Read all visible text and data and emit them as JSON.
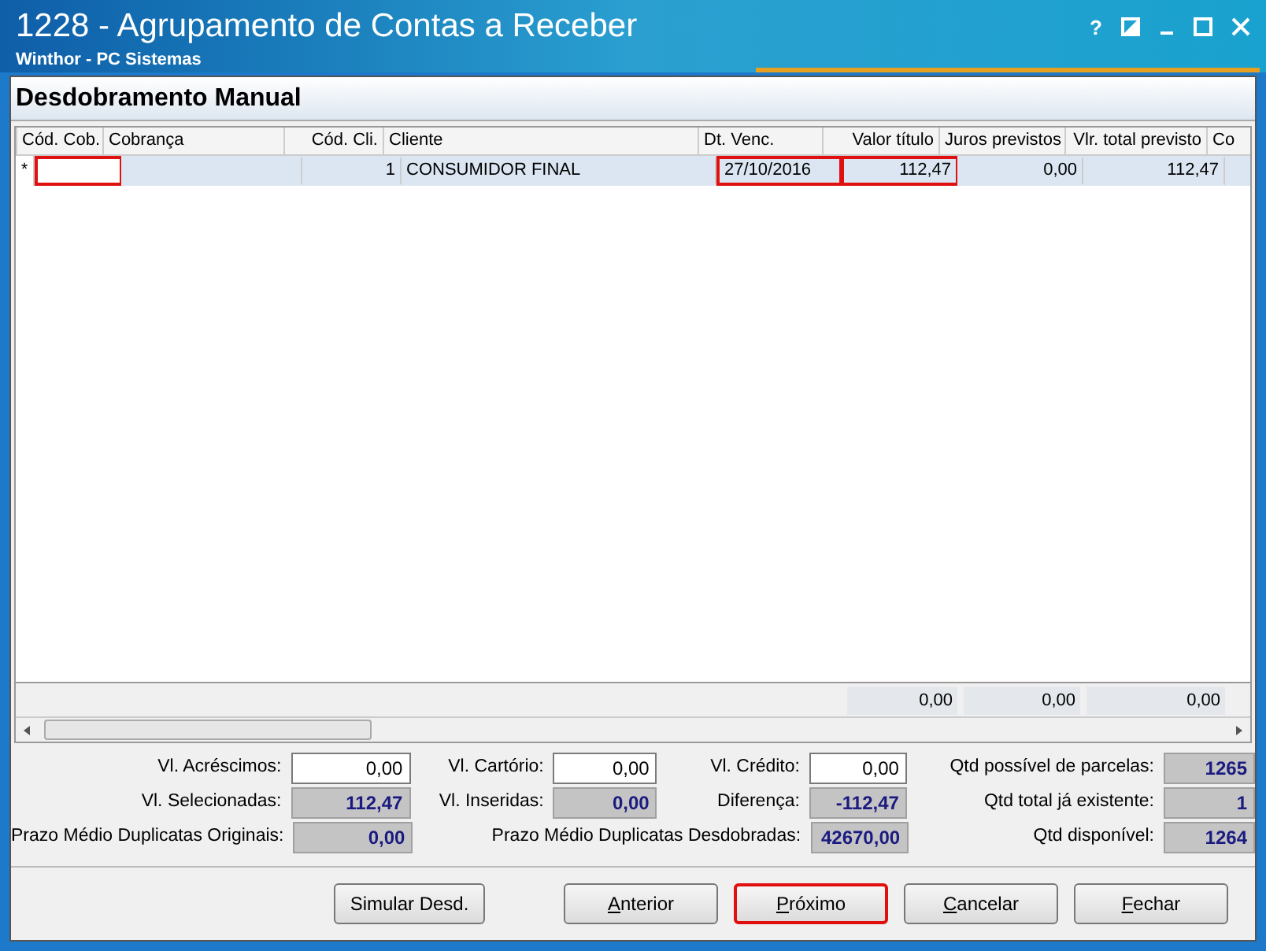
{
  "window": {
    "title": "1228 - Agrupamento de Contas a Receber",
    "subtitle": "Winthor - PC Sistemas",
    "controls": [
      "?"
    ]
  },
  "panel": {
    "title": "Desdobramento Manual"
  },
  "table": {
    "columns": [
      "Cód. Cob.",
      "Cobrança",
      "Cód. Cli.",
      "Cliente",
      "Dt. Venc.",
      "Valor título",
      "Juros previstos",
      "Vlr. total previsto",
      "Co"
    ],
    "rows": [
      {
        "marker": "*",
        "selected": true,
        "cells": [
          {
            "text": "",
            "highlighted": true
          },
          {
            "text": "",
            "highlighted": false
          },
          {
            "text": "1",
            "highlighted": false
          },
          {
            "text": "CONSUMIDOR FINAL",
            "highlighted": false
          },
          {
            "text": "27/10/2016",
            "highlighted": true
          },
          {
            "text": "112,47",
            "highlighted": true
          },
          {
            "text": "0,00",
            "highlighted": false
          },
          {
            "text": "112,47",
            "highlighted": false
          }
        ]
      }
    ],
    "totals": [
      "0,00",
      "0,00",
      "0,00"
    ]
  },
  "form": [
    [
      {
        "label": "Vl. Acréscimos:",
        "value": "0,00",
        "kind": "editable"
      },
      {
        "label": "Vl. Cartório:",
        "value": "0,00",
        "kind": "editable"
      },
      {
        "label": "Vl. Crédito:",
        "value": "0,00",
        "kind": "editable"
      },
      {
        "label": "Qtd possível de parcelas:",
        "value": "1265",
        "kind": "readonly"
      }
    ],
    [
      {
        "label": "Vl. Selecionadas:",
        "value": "112,47",
        "kind": "readonly"
      },
      {
        "label": "Vl. Inseridas:",
        "value": "0,00",
        "kind": "readonly"
      },
      {
        "label": "Diferença:",
        "value": "-112,47",
        "kind": "readonly"
      },
      {
        "label": "Qtd total já existente:",
        "value": "1",
        "kind": "readonly"
      }
    ],
    [
      {
        "label": "Prazo Médio Duplicatas Originais:",
        "value": "0,00",
        "kind": "readonly"
      },
      {
        "label": "Prazo Médio Duplicatas Desdobradas:",
        "value": "42670,00",
        "kind": "readonly"
      },
      {
        "label": "Qtd disponível:",
        "value": "1264",
        "kind": "readonly"
      }
    ]
  ],
  "buttons": [
    {
      "label": "Simular Desd.",
      "accelerator": false,
      "highlighted": false
    },
    {
      "label": "Anterior",
      "accelerator": true,
      "highlighted": false
    },
    {
      "label": "Próximo",
      "accelerator": true,
      "highlighted": true
    },
    {
      "label": "Cancelar",
      "accelerator": true,
      "highlighted": false
    },
    {
      "label": "Fechar",
      "accelerator": true,
      "highlighted": false
    }
  ]
}
